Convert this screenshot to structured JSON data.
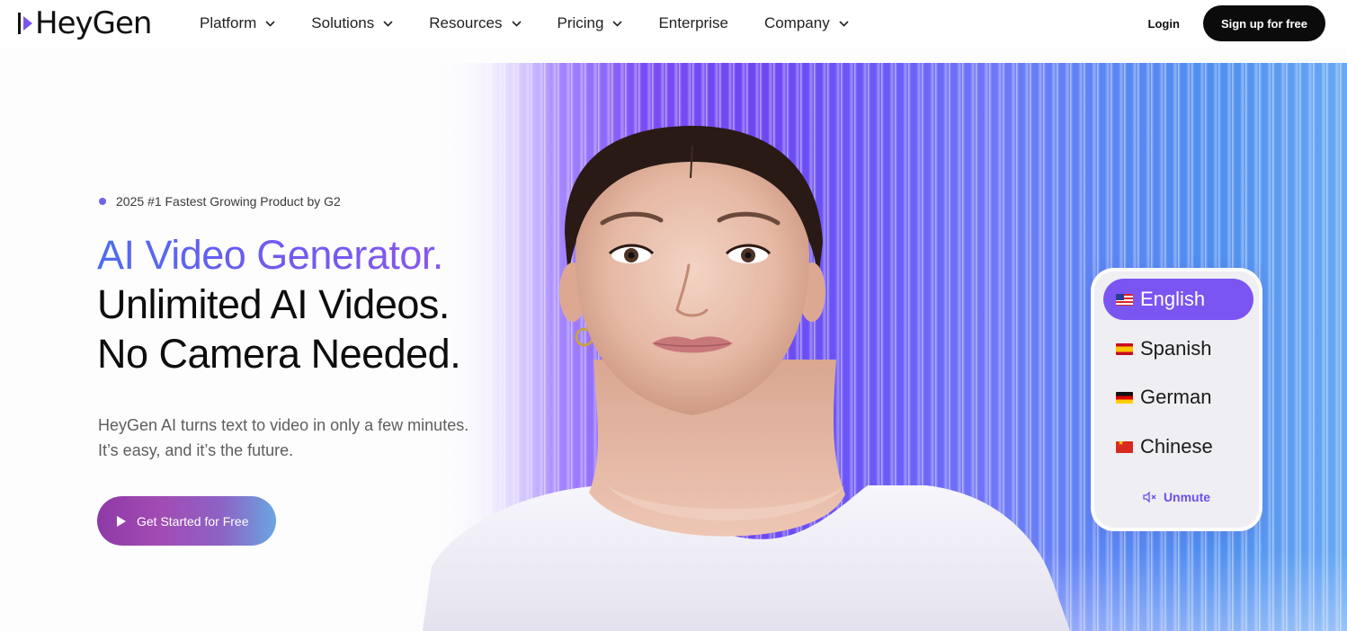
{
  "nav": {
    "logo_text": "HeyGen",
    "items": [
      {
        "label": "Platform",
        "has_dropdown": true
      },
      {
        "label": "Solutions",
        "has_dropdown": true
      },
      {
        "label": "Resources",
        "has_dropdown": true
      },
      {
        "label": "Pricing",
        "has_dropdown": true
      },
      {
        "label": "Enterprise",
        "has_dropdown": false
      },
      {
        "label": "Company",
        "has_dropdown": true
      }
    ],
    "login_label": "Login",
    "signup_label": "Sign up for free"
  },
  "hero": {
    "badge": "2025 #1 Fastest Growing Product by G2",
    "headline_accent": "AI Video Generator.",
    "headline_line2": "Unlimited AI Videos.",
    "headline_line3": "No Camera Needed.",
    "sub_line1": "HeyGen AI turns text to video in only a few minutes.",
    "sub_line2": "It’s easy, and it’s the future.",
    "cta_label": "Get Started for Free"
  },
  "language_panel": {
    "options": [
      {
        "label": "English",
        "flag": "us-flag-icon",
        "selected": true
      },
      {
        "label": "Spanish",
        "flag": "spain-flag-icon",
        "selected": false
      },
      {
        "label": "German",
        "flag": "germany-flag-icon",
        "selected": false
      },
      {
        "label": "Chinese",
        "flag": "china-flag-icon",
        "selected": false
      }
    ],
    "unmute_label": "Unmute",
    "unmute_icon": "muted-speaker-icon"
  },
  "colors": {
    "accent_purple": "#7b55f2",
    "cta_gradient_start": "#8e3aa6",
    "cta_gradient_end": "#69a6e0",
    "signup_bg": "#0b0b0b"
  }
}
